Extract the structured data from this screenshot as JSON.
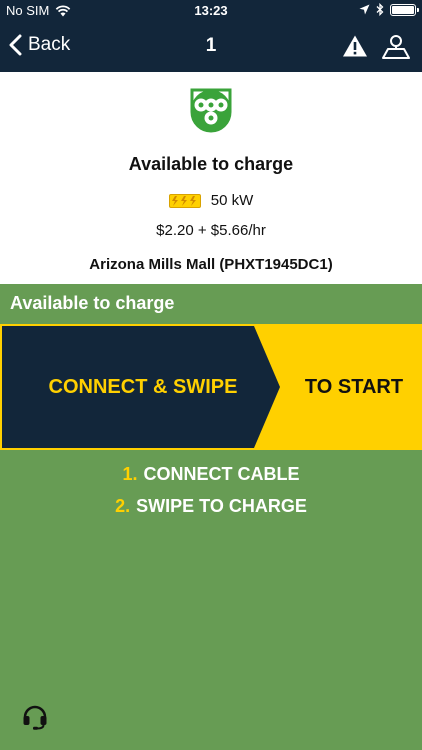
{
  "status_bar": {
    "carrier": "No SIM",
    "time": "13:23"
  },
  "nav": {
    "back_label": "Back",
    "title": "1"
  },
  "station": {
    "status": "Available to charge",
    "power": "50 kW",
    "price": "$2.20 + $5.66/hr",
    "name": "Arizona Mills Mall (PHXT1945DC1)"
  },
  "session": {
    "header": "Available to charge",
    "banner_left": "CONNECT & SWIPE",
    "banner_right": "TO START",
    "steps": [
      {
        "num": "1.",
        "text": "CONNECT CABLE"
      },
      {
        "num": "2.",
        "text": "SWIPE TO CHARGE"
      }
    ]
  },
  "colors": {
    "navy": "#12263a",
    "green": "#679c54",
    "accent_yellow": "#ffd000",
    "plug_green": "#3aa33a"
  },
  "icons": {
    "wifi": "wifi-icon",
    "location": "location-arrow-icon",
    "bluetooth": "bluetooth-icon",
    "battery": "battery-icon",
    "back": "chevron-left-icon",
    "warning": "warning-triangle-icon",
    "user_location": "user-location-icon",
    "connector": "ccs-connector-icon",
    "power": "lightning-bolts-icon",
    "support": "headset-icon"
  }
}
